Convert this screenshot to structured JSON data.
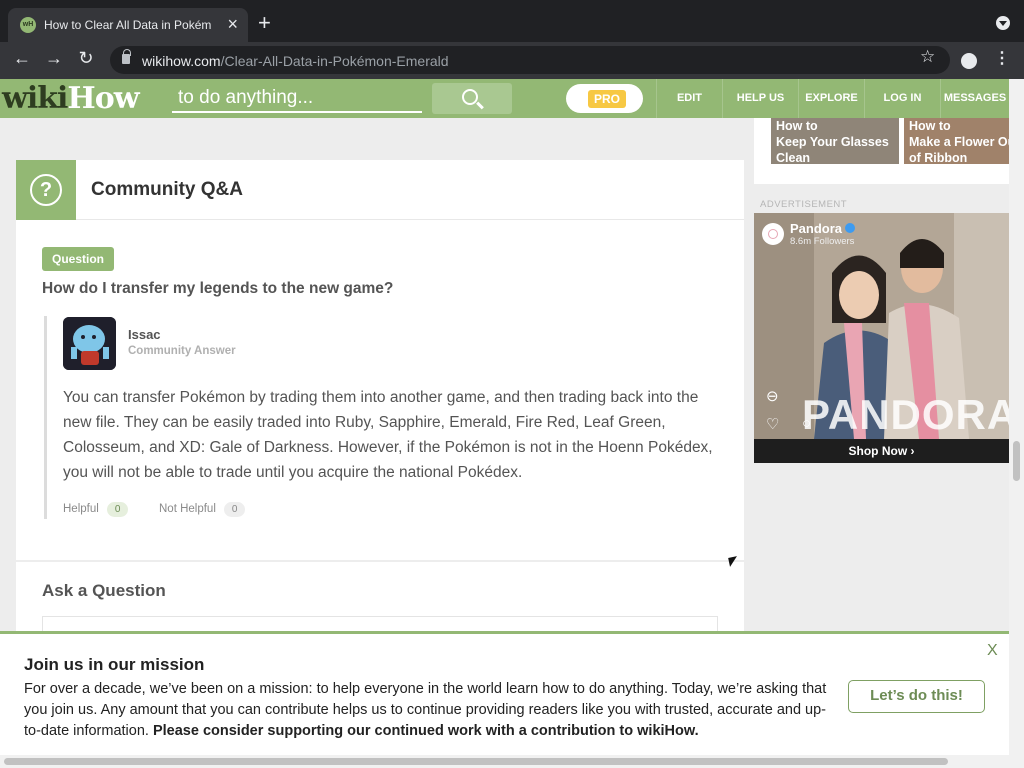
{
  "browser": {
    "tab_title": "How to Clear All Data in Pokém",
    "favicon_text": "wH",
    "url_host": "wikihow.com",
    "url_path": "/Clear-All-Data-in-Pokémon-Emerald"
  },
  "header": {
    "logo_wiki": "wiki",
    "logo_how": "How",
    "search_placeholder": "to do anything...",
    "pro_label": "PRO",
    "nav": [
      "EDIT",
      "HELP US",
      "EXPLORE",
      "LOG IN",
      "MESSAGES"
    ]
  },
  "qa": {
    "section_title": "Community Q&A",
    "question_badge": "Question",
    "question": "How do I transfer my legends to the new game?",
    "author": "Issac",
    "role": "Community Answer",
    "answer": "You can transfer Pokémon by trading them into another game, and then trading back into the new file. They can be easily traded into Ruby, Sapphire, Emerald, Fire Red, Leaf Green, Colosseum, and XD: Gale of Darkness. However, if the Pokémon is not in the Hoenn Pokédex, you will not be able to trade until you acquire the national Pokédex.",
    "helpful_label": "Helpful",
    "helpful_count": "0",
    "not_helpful_label": "Not Helpful",
    "not_helpful_count": "0"
  },
  "ask": {
    "title": "Ask a Question"
  },
  "sidebar": {
    "related": [
      {
        "line1": "How to",
        "line2": "Keep Your Glasses",
        "line3": "Clean"
      },
      {
        "line1": "How to",
        "line2": "Make a Flower Out",
        "line3": "of Ribbon"
      }
    ],
    "ad_label": "ADVERTISEMENT",
    "ad_brand": "Pandora",
    "ad_followers": "8.6m Followers",
    "ad_wordmark": "PANDORA",
    "ad_cta": "Shop Now  ›"
  },
  "banner": {
    "title": "Join us in our mission",
    "text": "For over a decade, we’ve been on a mission: to help everyone in the world learn how to do anything. Today, we’re asking that you join us. Any amount that you can contribute helps us to continue providing readers like you with trusted, accurate and up-to-date information.",
    "text_bold": "Please consider supporting our continued work with a contribution to wikiHow.",
    "button": "Let’s do this!",
    "close": "X"
  },
  "colors": {
    "brand_green": "#93b874",
    "dark_green": "#2e3d20",
    "browser_dark": "#202124"
  }
}
